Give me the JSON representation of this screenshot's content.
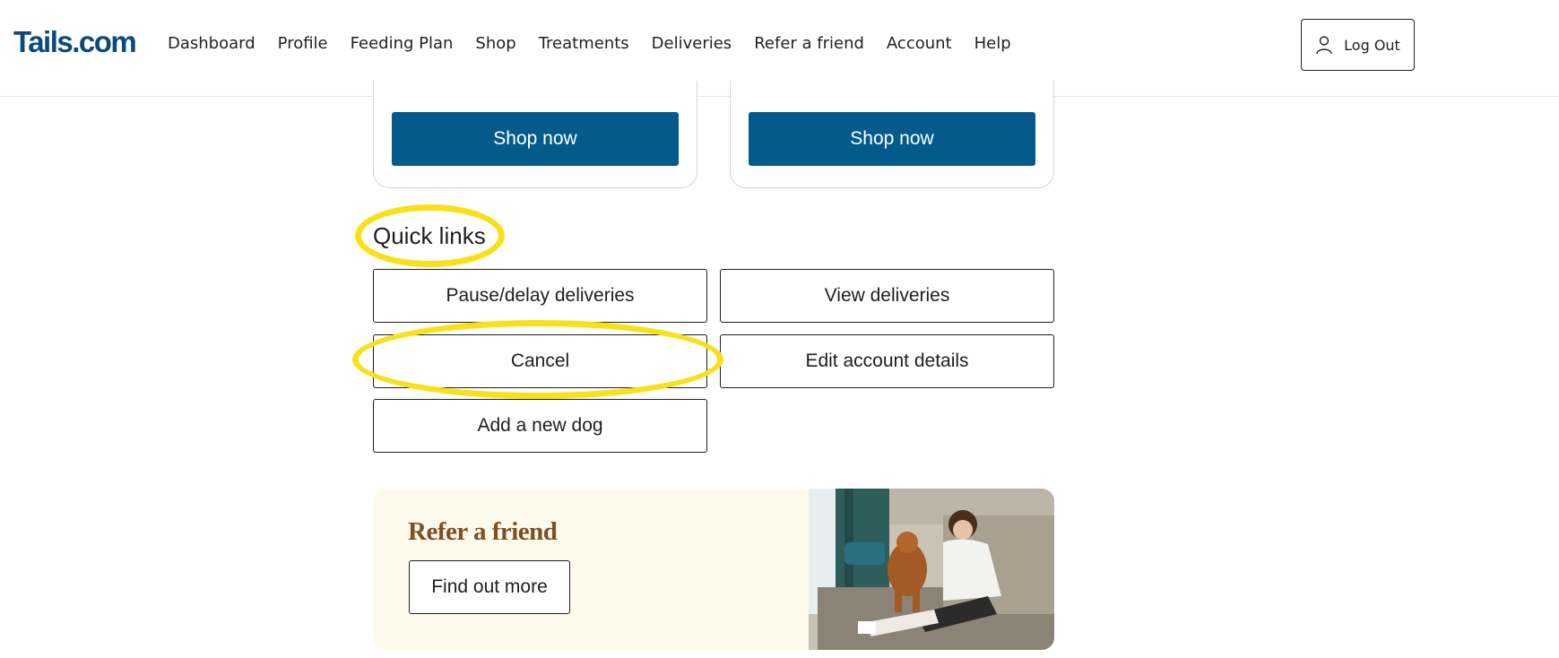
{
  "brand": {
    "logo_text": "Tails.com"
  },
  "nav": {
    "items": [
      "Dashboard",
      "Profile",
      "Feeding Plan",
      "Shop",
      "Treatments",
      "Deliveries",
      "Refer a friend",
      "Account",
      "Help"
    ]
  },
  "header": {
    "logout_label": "Log Out"
  },
  "shop_cards": [
    {
      "button_label": "Shop now"
    },
    {
      "button_label": "Shop now"
    }
  ],
  "quick_links": {
    "title": "Quick links",
    "buttons": [
      "Pause/delay deliveries",
      "View deliveries",
      "Cancel",
      "Edit account details",
      "Add a new dog"
    ]
  },
  "refer": {
    "title": "Refer a friend",
    "button_label": "Find out more"
  },
  "colors": {
    "brand_blue": "#055a8c",
    "highlight_yellow": "#f8e11a",
    "refer_bg": "#fdfaec",
    "refer_title": "#7d5021"
  }
}
